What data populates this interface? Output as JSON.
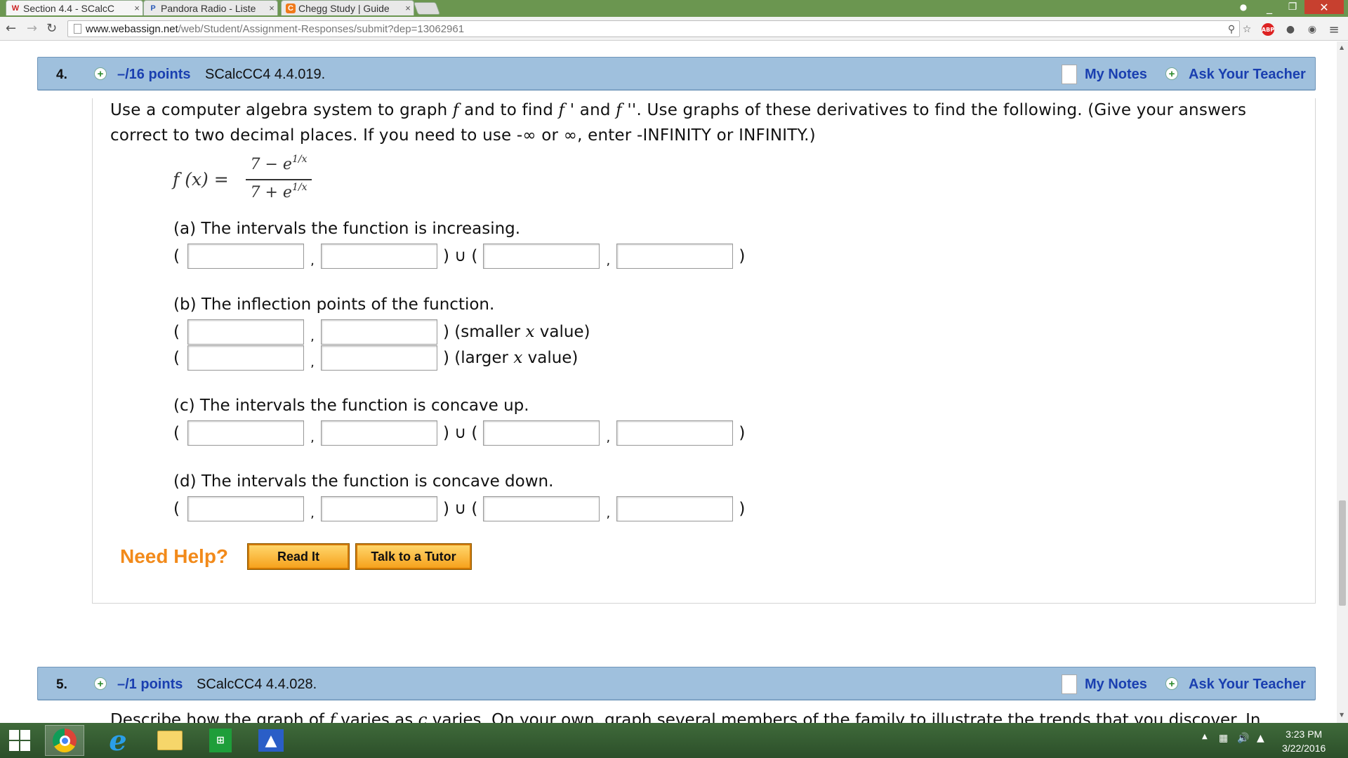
{
  "browser": {
    "tabs": [
      {
        "title": "Section 4.4 - SCalcC",
        "icon": "webassign-icon",
        "favicon_text": "W"
      },
      {
        "title": "Pandora Radio - Liste",
        "icon": "pandora-icon",
        "favicon_text": "P"
      },
      {
        "title": "Chegg Study | Guide",
        "icon": "chegg-icon",
        "favicon_text": "C"
      }
    ],
    "tab_close": "×",
    "url_host": "www.webassign.net",
    "url_path": "/web/Student/Assignment-Responses/submit?dep=13062961",
    "abp_label": "ABP",
    "window_close": "✕",
    "window_minimize": "_",
    "window_restore": "❐"
  },
  "questions": [
    {
      "number": "4.",
      "points": "–/16 points",
      "code": "SCalcCC4 4.4.019.",
      "my_notes": "My Notes",
      "ask_teacher": "Ask Your Teacher",
      "prompt_1": "Use a computer algebra system to graph ",
      "prompt_f": "f",
      "prompt_2": " and to find ",
      "prompt_fp": "f '",
      "prompt_3": " and ",
      "prompt_fpp": "f ''",
      "prompt_4": ". Use graphs of these derivatives to find the following. (Give your answers correct to two decimal places. If you need to use -∞ or ∞, enter -INFINITY or INFINITY.)",
      "formula": {
        "lhs": "f (x) =",
        "num_base": "7 − e",
        "num_exp": "1/x",
        "den_base": "7 + e",
        "den_exp": "1/x"
      },
      "parts": {
        "a": {
          "label": "(a) The intervals the function is increasing.",
          "union": ") ∪ (",
          "open": "(",
          "close": ")",
          "comma": ",",
          "inputs": [
            "",
            "",
            "",
            ""
          ]
        },
        "b": {
          "label": "(b) The inflection points of the function.",
          "open": "(",
          "comma": ",",
          "row1_tail_pre": ") (smaller ",
          "row1_tail_x": "x",
          "row1_tail_post": " value)",
          "row2_tail_pre": ") (larger ",
          "row2_tail_x": "x",
          "row2_tail_post": " value)",
          "inputs": [
            "",
            "",
            "",
            ""
          ]
        },
        "c": {
          "label": "(c) The intervals the function is concave up.",
          "union": ") ∪ (",
          "open": "(",
          "close": ")",
          "comma": ",",
          "inputs": [
            "",
            "",
            "",
            ""
          ]
        },
        "d": {
          "label": "(d) The intervals the function is concave down.",
          "union": ") ∪ (",
          "open": "(",
          "close": ")",
          "comma": ",",
          "inputs": [
            "",
            "",
            "",
            ""
          ]
        }
      },
      "need_help": "Need Help?",
      "read_it": "Read It",
      "talk_tutor": "Talk to a Tutor"
    },
    {
      "number": "5.",
      "points": "–/1 points",
      "code": "SCalcCC4 4.4.028.",
      "my_notes": "My Notes",
      "ask_teacher": "Ask Your Teacher",
      "prompt_1": "Describe how the graph of ",
      "prompt_f": "f",
      "prompt_2": " varies as ",
      "prompt_c": "c",
      "prompt_3": " varies. On your own, graph several members of the family to illustrate the trends that you discover. In"
    }
  ],
  "taskbar": {
    "icons": [
      "windows-start-icon",
      "chrome-icon",
      "internet-explorer-icon",
      "file-explorer-icon",
      "store-icon",
      "app-icon"
    ],
    "store_label": "⊞",
    "ie_label": "e",
    "time": "3:23 PM",
    "date": "3/22/2016"
  },
  "colors": {
    "header_bg": "#9fc0dd",
    "link_blue": "#1a3fb0",
    "need_help_orange": "#f28a1a",
    "button_orange": "#f6a21d"
  }
}
